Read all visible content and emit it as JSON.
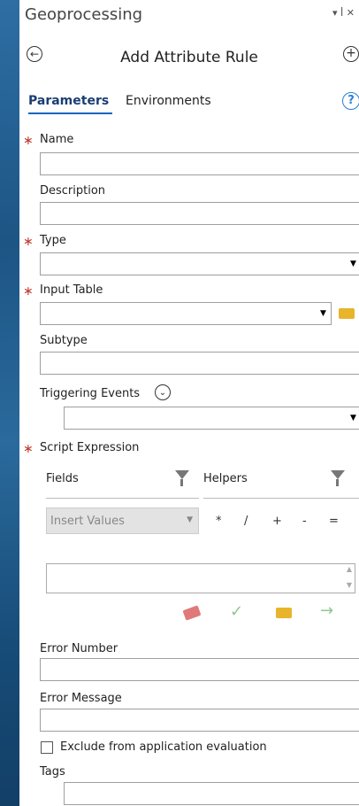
{
  "pane": {
    "title": "Geoprocessing",
    "pin_controls": "▾ ꟾ ✕"
  },
  "tool": {
    "title": "Add Attribute Rule"
  },
  "tabs": [
    {
      "label": "Parameters"
    },
    {
      "label": "Environments"
    }
  ],
  "help_icon": "?",
  "params": {
    "name_label": "Name",
    "description_label": "Description",
    "type_label": "Type",
    "input_table_label": "Input Table",
    "subtype_label": "Subtype",
    "triggering_events_label": "Triggering Events",
    "script_expression_label": "Script Expression",
    "fields_label": "Fields",
    "helpers_label": "Helpers",
    "insert_values_placeholder": "Insert Values",
    "operators": [
      "*",
      "/",
      "+",
      "-",
      "="
    ],
    "error_number_label": "Error Number",
    "error_message_label": "Error Message",
    "exclude_label": "Exclude from application evaluation",
    "tags_label": "Tags"
  },
  "required_marker": "∗",
  "colors": {
    "accent": "#1565c0",
    "required": "#c0392b",
    "folder": "#e8b42a"
  }
}
